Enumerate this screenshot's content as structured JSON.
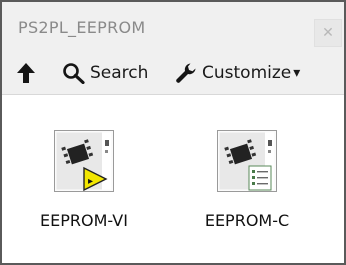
{
  "window": {
    "title": "PS2PL_EEPROM",
    "close_glyph": "✕"
  },
  "toolbar": {
    "up_icon": "arrow-up-icon",
    "search_label": "Search",
    "customize_label": "Customize",
    "dropdown_glyph": "▾"
  },
  "palette": {
    "items": [
      {
        "label": "EEPROM-VI",
        "icon": "chip-vi-icon"
      },
      {
        "label": "EEPROM-C",
        "icon": "chip-c-icon"
      }
    ]
  },
  "colors": {
    "titlebar_bg": "#f0f0f0",
    "border": "#5a5a5a",
    "vi_badge": "#f2e600"
  }
}
